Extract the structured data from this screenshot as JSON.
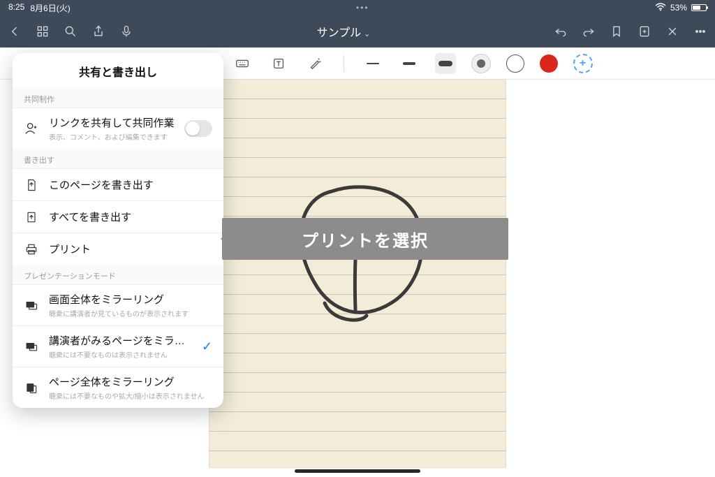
{
  "status": {
    "time": "8:25",
    "date": "8月6日(火)",
    "batteryText": "53%"
  },
  "nav": {
    "title": "サンプル"
  },
  "popover": {
    "title": "共有と書き出し",
    "sectionCollab": "共同制作",
    "collab": {
      "label": "リンクを共有して共同作業",
      "sub": "表示、コメント、および編集できます"
    },
    "sectionExport": "書き出す",
    "exportPage": "このページを書き出す",
    "exportAll": "すべてを書き出す",
    "print": "プリント",
    "sectionPresent": "プレゼンテーションモード",
    "mirrorFull": {
      "label": "画面全体をミラーリング",
      "sub": "聴衆に講演者が見ているものが表示されます"
    },
    "mirrorPresenter": {
      "label": "講演者がみるページをミラー…",
      "sub": "聴衆には不要なものは表示されません"
    },
    "mirrorPage": {
      "label": "ページ全体をミラーリング",
      "sub": "聴衆には不要なものや拡大/縮小は表示されません"
    }
  },
  "annotation": "プリントを選択"
}
